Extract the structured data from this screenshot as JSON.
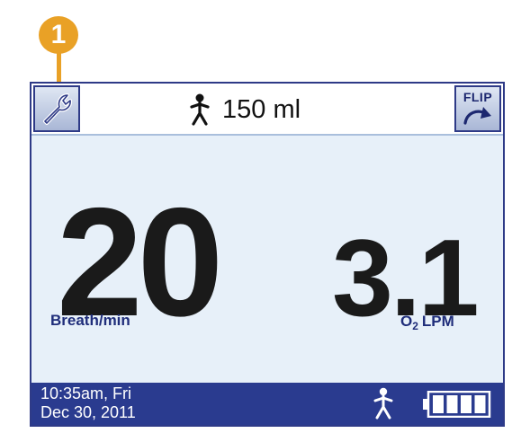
{
  "callout": {
    "number": "1",
    "color": "#e9a126"
  },
  "topbar": {
    "settings_icon": "wrench-icon",
    "volume_icon": "person-icon",
    "volume_text": "150 ml",
    "flip_label": "FLIP",
    "flip_icon": "flip-arrow-icon"
  },
  "main": {
    "breath_rate": "20",
    "breath_unit": "Breath/min",
    "o2_flow": "3.1",
    "o2_unit_prefix": "O",
    "o2_unit_sub": "2",
    "o2_unit_suffix": "LPM"
  },
  "statusbar": {
    "time": "10:35am, Fri",
    "date": "Dec 30, 2011",
    "patient_icon": "person-icon",
    "battery_icon": "battery-icon",
    "battery_level": 1.0
  },
  "colors": {
    "screen_bg": "#e7f0f9",
    "frame": "#2e3a87",
    "status_bar": "#2a3b8f",
    "label_text": "#1f2d7a"
  }
}
